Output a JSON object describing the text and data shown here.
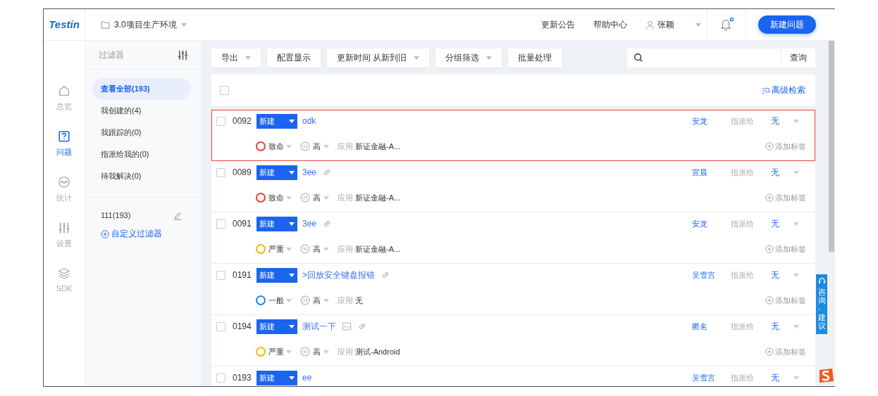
{
  "logo": "Testin",
  "project": {
    "name": "3.0项目生产环境"
  },
  "header_links": [
    "更新公告",
    "帮助中心"
  ],
  "user": {
    "name": "张颖"
  },
  "notifications": {
    "unread": true
  },
  "new_button": "新建问题",
  "nav": [
    {
      "label": "总览",
      "selected": false
    },
    {
      "label": "问题",
      "selected": true
    },
    {
      "label": "统计",
      "selected": false
    },
    {
      "label": "设置",
      "selected": false
    },
    {
      "label": "SDK",
      "selected": false
    }
  ],
  "filters": {
    "title": "过滤器",
    "items": [
      {
        "label": "查看全部(193)",
        "selected": true
      },
      {
        "label": "我创建的(4)",
        "selected": false
      },
      {
        "label": "我跟踪的(0)",
        "selected": false
      },
      {
        "label": "指派给我的(0)",
        "selected": false
      },
      {
        "label": "待我解决(0)",
        "selected": false
      }
    ],
    "custom": [
      {
        "label": "111(193)"
      }
    ],
    "add_custom": "自定义过滤器"
  },
  "toolbar": [
    {
      "label": "导出",
      "kind": "dropdown"
    },
    {
      "label": "配置显示",
      "kind": "button"
    },
    {
      "label": "更新时间 从新到旧",
      "kind": "dropdown"
    },
    {
      "label": "分组筛选",
      "kind": "dropdown"
    },
    {
      "label": "批量处理",
      "kind": "button"
    }
  ],
  "search": {
    "button": "查询"
  },
  "list_header": {
    "checked": false,
    "advanced_search": "高级检索"
  },
  "issues": [
    {
      "id": "0092",
      "status": "新建",
      "title": "odk",
      "has_image": false,
      "has_link": false,
      "selected": true,
      "checked": false,
      "severity": {
        "label": "致命",
        "color": "#e8413b"
      },
      "priority": "高",
      "app_label": "应用",
      "app": "新证金融-A...",
      "reporter": "安龙",
      "assign_label": "指派给",
      "assignee": "无",
      "add_tag": "添加标签"
    },
    {
      "id": "0089",
      "status": "新建",
      "title": "3ee",
      "has_image": false,
      "has_link": true,
      "selected": false,
      "checked": false,
      "severity": {
        "label": "致命",
        "color": "#e8413b"
      },
      "priority": "高",
      "app_label": "应用",
      "app": "新证金融-A...",
      "reporter": "宣晨",
      "assign_label": "指派给",
      "assignee": "无",
      "add_tag": "添加标签"
    },
    {
      "id": "0091",
      "status": "新建",
      "title": "3ee",
      "has_image": false,
      "has_link": true,
      "selected": false,
      "checked": false,
      "severity": {
        "label": "严重",
        "color": "#f5b800"
      },
      "priority": "高",
      "app_label": "应用",
      "app": "新证金融-A...",
      "reporter": "安龙",
      "assign_label": "指派给",
      "assignee": "无",
      "add_tag": "添加标签"
    },
    {
      "id": "0191",
      "status": "新建",
      "title": ">回放安全键盘报错",
      "has_image": false,
      "has_link": true,
      "selected": false,
      "checked": false,
      "severity": {
        "label": "一般",
        "color": "#1b87e0"
      },
      "priority": "高",
      "app_label": "应用",
      "app": "无",
      "reporter": "吴雪言",
      "assign_label": "指派给",
      "assignee": "无",
      "add_tag": "添加标签"
    },
    {
      "id": "0194",
      "status": "新建",
      "title": "测试一下",
      "has_image": true,
      "has_link": true,
      "selected": false,
      "checked": false,
      "severity": {
        "label": "严重",
        "color": "#f5b800"
      },
      "priority": "高",
      "app_label": "应用",
      "app": "测试-Android",
      "reporter": "匿名",
      "assign_label": "指派给",
      "assignee": "无",
      "add_tag": "添加标签"
    },
    {
      "id": "0193",
      "status": "新建",
      "title": "ee",
      "has_image": false,
      "has_link": false,
      "selected": false,
      "checked": false,
      "reporter": "吴雪言",
      "assign_label": "指派给",
      "assignee": "无"
    }
  ],
  "consult_tab": "咨询·建议"
}
